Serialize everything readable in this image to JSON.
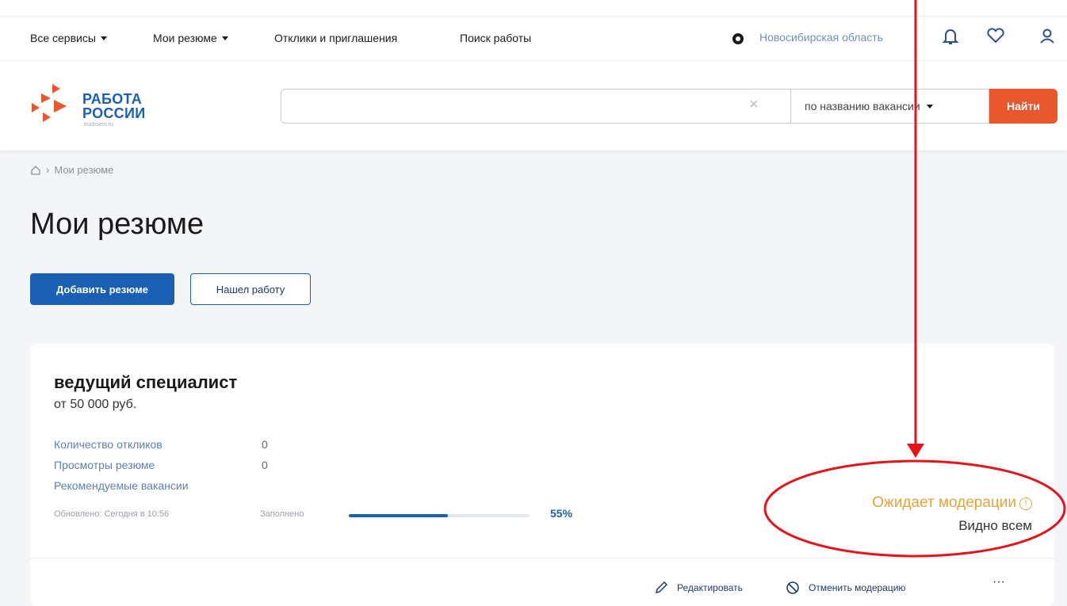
{
  "topnav": {
    "items": [
      {
        "label": "Все сервисы",
        "dropdown": true
      },
      {
        "label": "Мои резюме",
        "dropdown": true
      },
      {
        "label": "Отклики и приглашения",
        "dropdown": false
      },
      {
        "label": "Поиск работы",
        "dropdown": false
      }
    ],
    "region": "Новосибирская область",
    "icons": [
      "eye-icon",
      "bell-icon",
      "heart-icon",
      "user-icon"
    ]
  },
  "header": {
    "logo_line1": "РАБОТА",
    "logo_line2": "РОССИИ",
    "logo_sub": "trudvsem.ru",
    "search_value": "",
    "search_mode": "по названию вакансии",
    "search_button": "Найти"
  },
  "breadcrumb": {
    "current": "Мои резюме"
  },
  "page": {
    "title": "Мои резюме",
    "add_button": "Добавить резюме",
    "found_button": "Нашел работу"
  },
  "resume": {
    "title": "ведущий специалист",
    "salary": "от 50 000 руб.",
    "stats": [
      {
        "label": "Количество откликов",
        "value": "0"
      },
      {
        "label": "Просмотры резюме",
        "value": "0"
      },
      {
        "label": "Рекомендуемые вакансии",
        "value": ""
      }
    ],
    "updated": "Обновлено: Сегодня в 10:56",
    "filled_label": "Заполнено",
    "filled_percent": "55%",
    "filled_fraction": 0.55,
    "status": "Ожидает модерации",
    "visibility": "Видно всем",
    "actions": {
      "edit": "Редактировать",
      "cancel": "Отменить модерацию",
      "more": "···"
    }
  },
  "colors": {
    "brand_blue": "#1a5fb4",
    "accent_orange": "#e8582c",
    "status_yellow": "#e8a33a",
    "annotation_red": "#e5141b"
  }
}
